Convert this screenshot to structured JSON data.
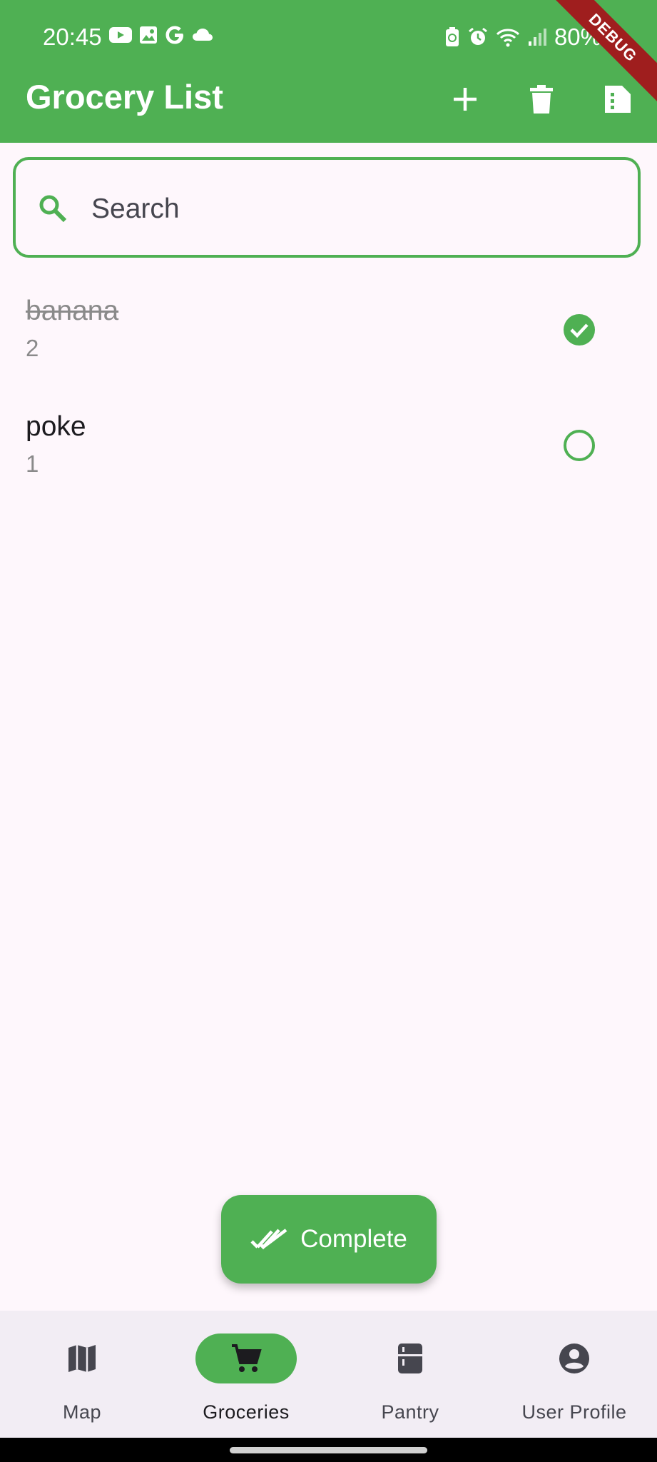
{
  "status_bar": {
    "time": "20:45",
    "battery": "80%",
    "debug_label": "DEBUG"
  },
  "app_bar": {
    "title": "Grocery List",
    "actions": [
      "add-icon",
      "delete-icon",
      "file-icon"
    ]
  },
  "search": {
    "placeholder": "Search",
    "value": ""
  },
  "items": [
    {
      "name": "banana",
      "quantity": "2",
      "checked": true
    },
    {
      "name": "poke",
      "quantity": "1",
      "checked": false
    }
  ],
  "fab": {
    "label": "Complete"
  },
  "nav": {
    "items": [
      {
        "label": "Map",
        "icon": "map-icon",
        "active": false
      },
      {
        "label": "Groceries",
        "icon": "cart-icon",
        "active": true
      },
      {
        "label": "Pantry",
        "icon": "fridge-icon",
        "active": false
      },
      {
        "label": "User Profile",
        "icon": "account-icon",
        "active": false
      }
    ]
  },
  "colors": {
    "primary": "#4FB053",
    "background": "#FEF7FC",
    "debug_banner": "#9F1E1E"
  }
}
